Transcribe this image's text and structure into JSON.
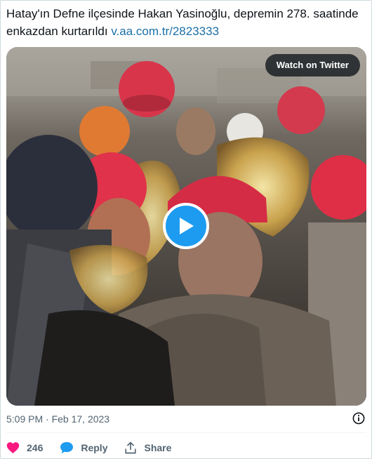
{
  "tweet": {
    "text": "Hatay'ın Defne ilçesinde Hakan Yasinoğlu, depremin 278. saatinde enkazdan kurtarıldı",
    "link": "v.aa.com.tr/2823333",
    "timestamp": "5:09 PM · Feb 17, 2023"
  },
  "media": {
    "watch_label": "Watch on Twitter",
    "play_icon": "play-icon"
  },
  "actions": {
    "like_count": "246",
    "reply_label": "Reply",
    "share_label": "Share"
  },
  "colors": {
    "accent": "#1d9bf0",
    "like": "#f91880",
    "link": "#1b6fa8"
  }
}
